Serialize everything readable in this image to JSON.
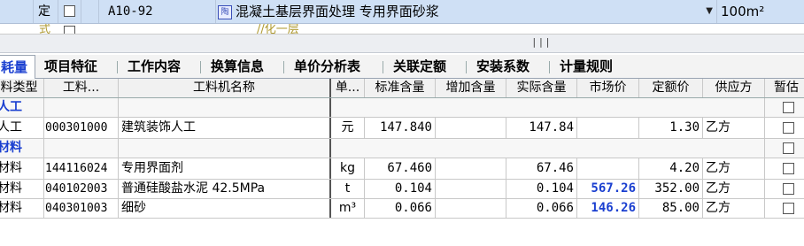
{
  "top_row": {
    "status": "定",
    "code": "A10-92",
    "item_type_badge": "陶",
    "name": "混凝土基层界面处理 专用界面砂浆",
    "dropdown_icon": "triangle-down-icon",
    "quantity": "100m²"
  },
  "second_row": {
    "left_text": "式",
    "mid_text": "//化一层"
  },
  "splitter": {
    "grip": "|||"
  },
  "tabs": [
    {
      "label": "耗量"
    },
    {
      "label": "项目特征"
    },
    {
      "label": "工作内容"
    },
    {
      "label": "换算信息"
    },
    {
      "label": "单价分析表"
    },
    {
      "label": "关联定额"
    },
    {
      "label": "安装系数"
    },
    {
      "label": "计量规则"
    }
  ],
  "table": {
    "headers": [
      "料类型",
      "工料...",
      "工料机名称",
      "单...",
      "标准含量",
      "增加含量",
      "实际含量",
      "市场价",
      "定额价",
      "供应方",
      "暂估"
    ],
    "rows": [
      {
        "kind": "group",
        "type": "人工"
      },
      {
        "kind": "item",
        "type": "人工",
        "code": "000301000",
        "name": "建筑装饰人工",
        "unit": "元",
        "std_qty": "147.840",
        "add_qty": "",
        "actual_qty": "147.84",
        "market_price": "",
        "quota_price": "1.30",
        "supplier": "乙方"
      },
      {
        "kind": "group",
        "type": "材料"
      },
      {
        "kind": "item",
        "type": "材料",
        "code": "144116024",
        "name": "专用界面剂",
        "unit": "kg",
        "std_qty": "67.460",
        "add_qty": "",
        "actual_qty": "67.46",
        "market_price": "",
        "quota_price": "4.20",
        "supplier": "乙方"
      },
      {
        "kind": "item",
        "type": "材料",
        "code": "040102003",
        "name": "普通硅酸盐水泥 42.5MPa",
        "unit": "t",
        "std_qty": "0.104",
        "add_qty": "",
        "actual_qty": "0.104",
        "market_price": "567.26",
        "quota_price": "352.00",
        "supplier": "乙方"
      },
      {
        "kind": "item",
        "type": "材料",
        "code": "040301003",
        "name": "细砂",
        "unit": "m³",
        "std_qty": "0.066",
        "add_qty": "",
        "actual_qty": "0.066",
        "market_price": "146.26",
        "quota_price": "85.00",
        "supplier": "乙方"
      }
    ]
  }
}
